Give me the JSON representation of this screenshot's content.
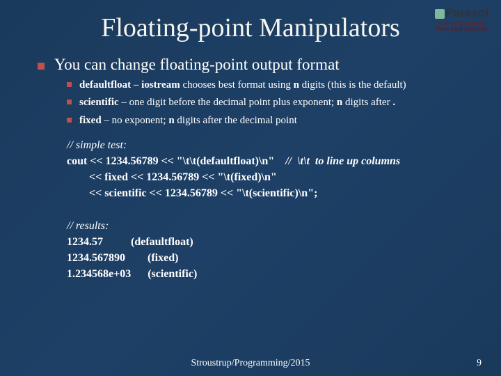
{
  "logo": {
    "brand": "Parasol",
    "tagline": "Smarter computing.",
    "affiliation": "Texas A&M University"
  },
  "title": "Floating-point Manipulators",
  "main_point": "You can change floating-point output format",
  "sub_points": [
    {
      "term": "defaultfloat",
      "sep": " – ",
      "term2": "iostream",
      "rest1": " chooses best format using ",
      "n": "n",
      "rest2": " digits (this is the default)"
    },
    {
      "term": "scientific",
      "sep": " – ",
      "rest1": "one digit before the decimal point plus exponent; ",
      "n": "n",
      "rest2": " digits after ",
      "dot": "."
    },
    {
      "term": "fixed",
      "sep": " – ",
      "rest1": "no exponent; ",
      "n": "n",
      "rest2": " digits after the decimal point"
    }
  ],
  "code": {
    "c1_comment": "// simple test:",
    "c2_a": "cout << 1234.56789 << \"\\t\\t(defaultfloat)\\n\"    ",
    "c2_b": "//  \\t\\t  to line up columns",
    "c3": "        << fixed << 1234.56789 << \"\\t(fixed)\\n\"",
    "c4": "        << scientific << 1234.56789 << \"\\t(scientific)\\n\";",
    "r1_comment": "// results:",
    "r2": "1234.57          (defaultfloat)",
    "r3": "1234.567890        (fixed)",
    "r4": "1.234568e+03      (scientific)"
  },
  "footer": "Stroustrup/Programming/2015",
  "page_number": "9"
}
